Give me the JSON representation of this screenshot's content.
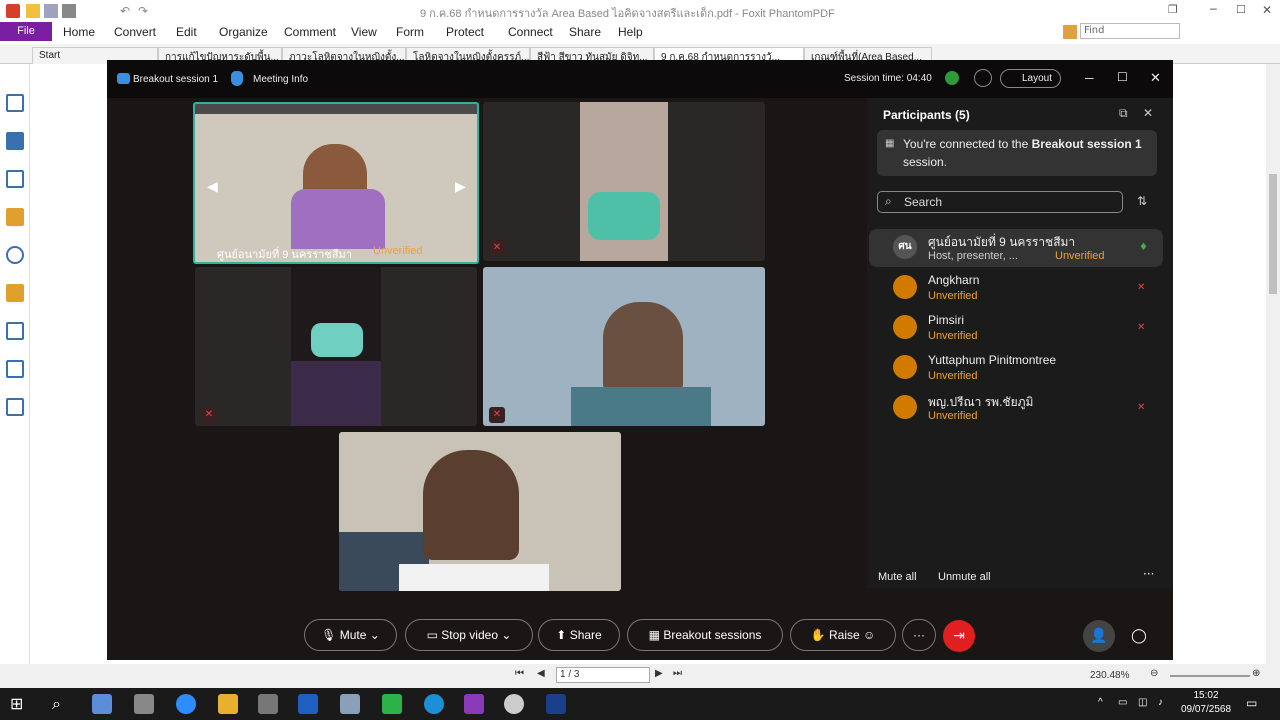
{
  "window": {
    "title": "9 ก.ค.68 กำหนดการรางวัล Area Based ไอคิดจางสตรีและเด็ก.pdf - Foxit PhantomPDF"
  },
  "menu": {
    "file": "File",
    "items": [
      "Home",
      "Convert",
      "Edit",
      "Organize",
      "Comment",
      "View",
      "Form",
      "Protect",
      "Connect",
      "Share",
      "Help"
    ]
  },
  "find": {
    "placeholder": "Find"
  },
  "tabs": [
    "Start",
    "การแก้ไขปัญหาระดับพื้น...",
    "ภาวะโลหิตจางในหญิงตั้ง...",
    "โลหิตจางในหญิงตั้งครรภ์...",
    "สีฟ้า สีขาว ทันสมัย ดิจิท...",
    "9 ก.ค.68 กำหนดการรางวั...",
    "เกณฑ์พื้นที่(Area Based..."
  ],
  "zoom": {
    "breakout": "Breakout session 1",
    "meeting_info": "Meeting Info",
    "session_time": "Session time: 04:40",
    "layout": "Layout",
    "tile1_name": "ศูนย์อนามัยที่ 9 นครราชสีมา",
    "tile1_status": "Unverified",
    "participants_title": "Participants (5)",
    "notice_pre": "You're connected to the ",
    "notice_bold": "Breakout session 1",
    "notice_post": " session.",
    "search": "Search",
    "participants": [
      {
        "initials": "ศน",
        "name": "ศูนย์อนามัยที่ 9 นครราชสีมา",
        "role": "Host, presenter, ...",
        "status": "Unverified"
      },
      {
        "name": "Angkharn",
        "status": "Unverified"
      },
      {
        "name": "Pimsiri",
        "status": "Unverified"
      },
      {
        "name": "Yuttaphum Pinitmontree",
        "status": "Unverified"
      },
      {
        "name": "พญ.ปรีณา รพ.ชัยภูมิ",
        "status": "Unverified"
      }
    ],
    "mute_all": "Mute all",
    "unmute_all": "Unmute all",
    "controls": {
      "mute": "Mute",
      "stop_video": "Stop video",
      "share": "Share",
      "breakout": "Breakout sessions",
      "raise": "Raise"
    }
  },
  "pdf_bar": {
    "page": "1 / 3",
    "zoom": "230.48%"
  },
  "taskbar": {
    "time": "15:02",
    "date": "09/07/2568"
  },
  "colors": {
    "file_tab": "#7a1fa2",
    "unverified": "#f0a030",
    "leave": "#e02020",
    "tile_border": "#2fb3a0"
  }
}
